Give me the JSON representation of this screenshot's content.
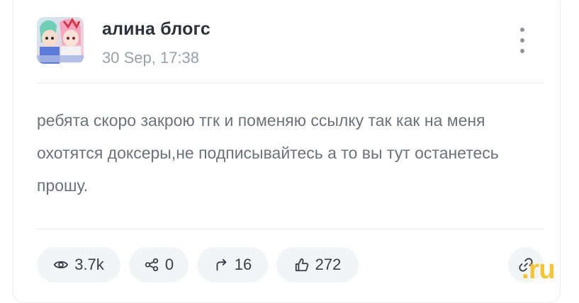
{
  "post": {
    "author": "алина блогс",
    "timestamp": "30 Sep, 17:38",
    "text": "ребята скоро закрою тгк и поменяю ссылку так как на меня охотятся доксеры,не подписывайтесь а то вы тут останетесь прошу."
  },
  "stats": {
    "views": "3.7k",
    "shares": "0",
    "reposts": "16",
    "likes": "272"
  },
  "icons": {
    "menu": "more-vertical-icon",
    "views": "eye-icon",
    "shares": "share-nodes-icon",
    "reposts": "repost-arrow-icon",
    "likes": "thumbs-up-icon",
    "link": "link-icon"
  },
  "watermark": ".ru",
  "colors": {
    "author": "#2e3139",
    "muted": "#9aa0aa",
    "body_text": "#6d717a",
    "pill_bg": "#f3f4f6",
    "watermark": "#f3c436"
  }
}
